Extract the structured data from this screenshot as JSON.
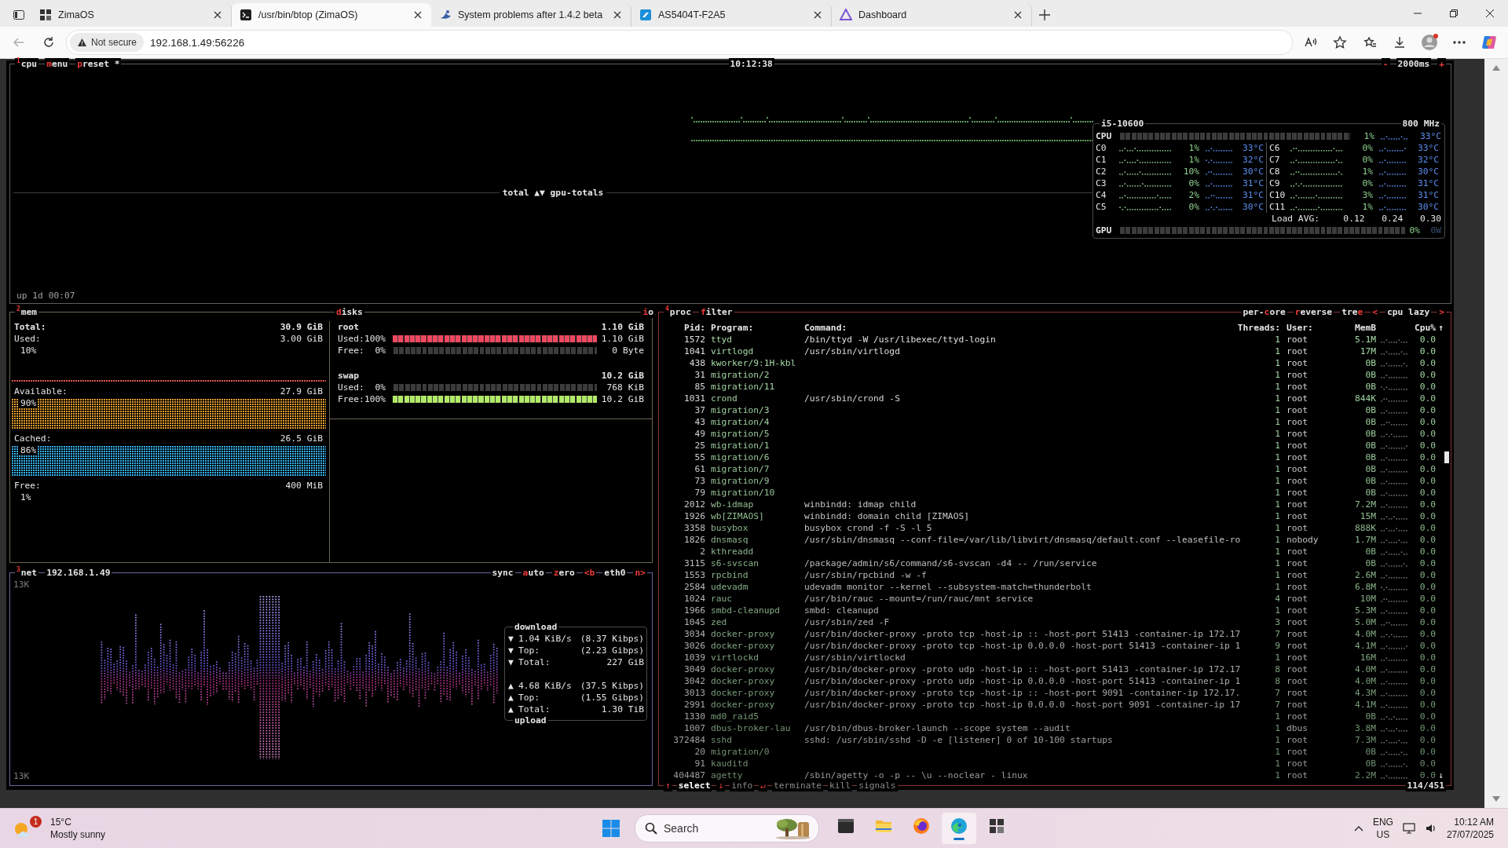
{
  "browser": {
    "tabs": [
      {
        "title": "ZimaOS",
        "kind": "zima",
        "selected": false
      },
      {
        "title": "/usr/bin/btop (ZimaOS)",
        "kind": "terminal",
        "selected": true
      },
      {
        "title": "System problems after 1.4.2 beta",
        "kind": "forum",
        "selected": false
      },
      {
        "title": "AS5404T-F2A5",
        "kind": "nas",
        "selected": false
      },
      {
        "title": "Dashboard",
        "kind": "dashboard",
        "selected": false
      }
    ],
    "security": "Not secure",
    "url": "192.168.1.49:56226"
  },
  "cpu": {
    "title": {
      "number": "1",
      "label": "cpu"
    },
    "buttons": [
      {
        "hotkey": "m",
        "rest": "enu"
      },
      {
        "hotkey": "p",
        "rest": "reset *"
      }
    ],
    "clock": "10:12:38",
    "interval": {
      "minus": "-",
      "value": "2000ms",
      "plus": "+"
    },
    "graph_label": "total ▲▼ gpu-totals",
    "uptime": "up 1d 00:07",
    "model": "i5-10600",
    "frequency": "800 MHz",
    "total": {
      "label": "CPU",
      "percent": "1%",
      "temp": "33°C"
    },
    "cores": [
      {
        "name": "C0",
        "percent": "1%",
        "temp": "33°C"
      },
      {
        "name": "C1",
        "percent": "1%",
        "temp": "32°C"
      },
      {
        "name": "C2",
        "percent": "10%",
        "temp": "30°C"
      },
      {
        "name": "C3",
        "percent": "0%",
        "temp": "31°C"
      },
      {
        "name": "C4",
        "percent": "2%",
        "temp": "31°C"
      },
      {
        "name": "C5",
        "percent": "0%",
        "temp": "30°C"
      },
      {
        "name": "C6",
        "percent": "0%",
        "temp": "33°C"
      },
      {
        "name": "C7",
        "percent": "0%",
        "temp": "32°C"
      },
      {
        "name": "C8",
        "percent": "1%",
        "temp": "30°C"
      },
      {
        "name": "C9",
        "percent": "0%",
        "temp": "31°C"
      },
      {
        "name": "C10",
        "percent": "3%",
        "temp": "31°C"
      },
      {
        "name": "C11",
        "percent": "1%",
        "temp": "30°C"
      }
    ],
    "load": {
      "label": "Load AVG:",
      "values": [
        "0.12",
        "0.24",
        "0.30"
      ]
    },
    "gpu": {
      "label": "GPU",
      "percent": "0%",
      "watts": "0W"
    }
  },
  "mem": {
    "title": {
      "number": "2",
      "label": "mem"
    },
    "total": {
      "label": "Total:",
      "value": "30.9 GiB"
    },
    "stats": [
      {
        "label": "Used:",
        "value": "3.00 GiB",
        "percent": "10%",
        "kind": "line",
        "color": "#e0584f"
      },
      {
        "label": "Available:",
        "value": "27.9 GiB",
        "percent": "90%",
        "kind": "fill",
        "color": "#e8a02c"
      },
      {
        "label": "Cached:",
        "value": "26.5 GiB",
        "percent": "86%",
        "kind": "fill",
        "color": "#35b2ee"
      },
      {
        "label": "Free:",
        "value": "400 MiB",
        "percent": "1%",
        "kind": "none"
      }
    ]
  },
  "disks": {
    "title": {
      "hotkey": "d",
      "rest": "isks"
    },
    "io": {
      "hotkey": "i",
      "rest": "o"
    },
    "devices": [
      {
        "name": "root",
        "size": "1.10 GiB",
        "rows": [
          {
            "label": "Used:",
            "percent": "100%",
            "level": 1,
            "value": "1.10 GiB",
            "kind": "used"
          },
          {
            "label": "Free:",
            "percent": "0%",
            "value": "0 Byte",
            "kind": "free"
          }
        ]
      },
      {
        "name": "swap",
        "size": "10.2 GiB",
        "rows": [
          {
            "label": "Used:",
            "percent": "0%",
            "value": "768 KiB",
            "kind": "used"
          },
          {
            "label": "Free:",
            "percent": "100%",
            "level": 1,
            "value": "10.2 GiB",
            "kind": "free"
          }
        ]
      }
    ]
  },
  "net": {
    "title": {
      "number": "3",
      "label": "net"
    },
    "address": "192.168.1.49",
    "buttons": [
      {
        "rest": "sync"
      },
      {
        "hotkey": "a",
        "rest": "uto"
      },
      {
        "hotkey": "z",
        "rest": "ero"
      }
    ],
    "interface": {
      "prev": "<b",
      "name": "eth0",
      "next": "n>"
    },
    "scale_top": "13K",
    "scale_bottom": "13K",
    "download": {
      "title": "download",
      "rows": [
        {
          "icon": "▼",
          "label": "1.04 KiB/s",
          "value": "(8.37 Kibps)"
        },
        {
          "icon": "▼",
          "label": "Top:",
          "value": "(2.23 Gibps)"
        },
        {
          "icon": "▼",
          "label": "Total:",
          "value": "227 GiB"
        }
      ]
    },
    "upload": {
      "title": "upload",
      "rows": [
        {
          "icon": "▲",
          "label": "4.68 KiB/s",
          "value": "(37.5 Kibps)"
        },
        {
          "icon": "▲",
          "label": "Top:",
          "value": "(1.55 Gibps)"
        },
        {
          "icon": "▲",
          "label": "Total:",
          "value": "1.30 TiB"
        }
      ]
    }
  },
  "proc": {
    "title": {
      "number": "4",
      "label": "proc"
    },
    "filter": {
      "hotkey": "f",
      "rest": "ilter"
    },
    "options": [
      {
        "prefix": "per-",
        "hotkey": "c",
        "rest": "ore"
      },
      {
        "hotkey": "r",
        "rest": "everse"
      },
      {
        "prefix": "tre",
        "hotkey": "e"
      }
    ],
    "sort": {
      "prev": "<",
      "label": "cpu lazy",
      "next": ">"
    },
    "columns": [
      "Pid:",
      "Program:",
      "Command:",
      "Threads:",
      "User:",
      "MemB",
      "Cpu%"
    ],
    "sort_arrow": "↑",
    "end_arrow": "↓",
    "rows": [
      {
        "pid": "1572",
        "program": "ttyd",
        "command": "/bin/ttyd -W /usr/libexec/ttyd-login",
        "threads": "1",
        "user": "root",
        "mem": "5.1M",
        "cpu": "0.0"
      },
      {
        "pid": "1041",
        "program": "virtlogd",
        "command": "/usr/sbin/virtlogd",
        "threads": "1",
        "user": "root",
        "mem": "17M",
        "cpu": "0.0"
      },
      {
        "pid": "438",
        "program": "kworker/9:1H-kbl",
        "threads": "1",
        "user": "root",
        "mem": "0B",
        "cpu": "0.0"
      },
      {
        "pid": "31",
        "program": "migration/2",
        "threads": "1",
        "user": "root",
        "mem": "0B",
        "cpu": "0.0"
      },
      {
        "pid": "85",
        "program": "migration/11",
        "threads": "1",
        "user": "root",
        "mem": "0B",
        "cpu": "0.0"
      },
      {
        "pid": "1031",
        "program": "crond",
        "command": "/usr/sbin/crond -S",
        "threads": "1",
        "user": "root",
        "mem": "844K",
        "cpu": "0.0"
      },
      {
        "pid": "37",
        "program": "migration/3",
        "threads": "1",
        "user": "root",
        "mem": "0B",
        "cpu": "0.0"
      },
      {
        "pid": "43",
        "program": "migration/4",
        "threads": "1",
        "user": "root",
        "mem": "0B",
        "cpu": "0.0"
      },
      {
        "pid": "49",
        "program": "migration/5",
        "threads": "1",
        "user": "root",
        "mem": "0B",
        "cpu": "0.0"
      },
      {
        "pid": "25",
        "program": "migration/1",
        "threads": "1",
        "user": "root",
        "mem": "0B",
        "cpu": "0.0"
      },
      {
        "pid": "55",
        "program": "migration/6",
        "threads": "1",
        "user": "root",
        "mem": "0B",
        "cpu": "0.0"
      },
      {
        "pid": "61",
        "program": "migration/7",
        "threads": "1",
        "user": "root",
        "mem": "0B",
        "cpu": "0.0"
      },
      {
        "pid": "73",
        "program": "migration/9",
        "threads": "1",
        "user": "root",
        "mem": "0B",
        "cpu": "0.0"
      },
      {
        "pid": "79",
        "program": "migration/10",
        "threads": "1",
        "user": "root",
        "mem": "0B",
        "cpu": "0.0"
      },
      {
        "pid": "2012",
        "program": "wb-idmap",
        "command": "winbindd: idmap child",
        "threads": "1",
        "user": "root",
        "mem": "7.2M",
        "cpu": "0.0"
      },
      {
        "pid": "1926",
        "program": "wb[ZIMAOS]",
        "command": "winbindd: domain child [ZIMAOS]",
        "threads": "1",
        "user": "root",
        "mem": "15M",
        "cpu": "0.0"
      },
      {
        "pid": "3358",
        "program": "busybox",
        "command": "busybox crond -f -S -l 5",
        "threads": "1",
        "user": "root",
        "mem": "888K",
        "cpu": "0.0"
      },
      {
        "pid": "1826",
        "program": "dnsmasq",
        "command": "/usr/sbin/dnsmasq --conf-file=/var/lib/libvirt/dnsmasq/default.conf --leasefile-ro",
        "threads": "1",
        "user": "nobody",
        "mem": "1.7M",
        "cpu": "0.0"
      },
      {
        "pid": "2",
        "program": "kthreadd",
        "threads": "1",
        "user": "root",
        "mem": "0B",
        "cpu": "0.0"
      },
      {
        "pid": "3115",
        "program": "s6-svscan",
        "command": "/package/admin/s6/command/s6-svscan -d4 -- /run/service",
        "threads": "1",
        "user": "root",
        "mem": "0B",
        "cpu": "0.0"
      },
      {
        "pid": "1553",
        "program": "rpcbind",
        "command": "/usr/sbin/rpcbind -w -f",
        "threads": "1",
        "user": "root",
        "mem": "2.6M",
        "cpu": "0.0"
      },
      {
        "pid": "2584",
        "program": "udevadm",
        "command": "udevadm monitor --kernel --subsystem-match=thunderbolt",
        "threads": "1",
        "user": "root",
        "mem": "6.8M",
        "cpu": "0.0"
      },
      {
        "pid": "1024",
        "program": "rauc",
        "command": "/usr/bin/rauc --mount=/run/rauc/mnt service",
        "threads": "4",
        "user": "root",
        "mem": "10M",
        "cpu": "0.0"
      },
      {
        "pid": "1966",
        "program": "smbd-cleanupd",
        "command": "smbd: cleanupd",
        "threads": "1",
        "user": "root",
        "mem": "5.3M",
        "cpu": "0.0"
      },
      {
        "pid": "1045",
        "program": "zed",
        "command": "/usr/sbin/zed -F",
        "threads": "3",
        "user": "root",
        "mem": "5.0M",
        "cpu": "0.0"
      },
      {
        "pid": "3034",
        "program": "docker-proxy",
        "command": "/usr/bin/docker-proxy -proto tcp -host-ip :: -host-port 51413 -container-ip 172.17",
        "threads": "7",
        "user": "root",
        "mem": "4.0M",
        "cpu": "0.0"
      },
      {
        "pid": "3026",
        "program": "docker-proxy",
        "command": "/usr/bin/docker-proxy -proto tcp -host-ip 0.0.0.0 -host-port 51413 -container-ip 1",
        "threads": "9",
        "user": "root",
        "mem": "4.1M",
        "cpu": "0.0"
      },
      {
        "pid": "1039",
        "program": "virtlockd",
        "command": "/usr/sbin/virtlockd",
        "threads": "1",
        "user": "root",
        "mem": "16M",
        "cpu": "0.0"
      },
      {
        "pid": "3049",
        "program": "docker-proxy",
        "command": "/usr/bin/docker-proxy -proto udp -host-ip :: -host-port 51413 -container-ip 172.17",
        "threads": "8",
        "user": "root",
        "mem": "4.0M",
        "cpu": "0.0"
      },
      {
        "pid": "3042",
        "program": "docker-proxy",
        "command": "/usr/bin/docker-proxy -proto udp -host-ip 0.0.0.0 -host-port 51413 -container-ip 1",
        "threads": "8",
        "user": "root",
        "mem": "4.0M",
        "cpu": "0.0"
      },
      {
        "pid": "3013",
        "program": "docker-proxy",
        "command": "/usr/bin/docker-proxy -proto tcp -host-ip :: -host-port 9091 -container-ip 172.17.",
        "threads": "7",
        "user": "root",
        "mem": "4.3M",
        "cpu": "0.0"
      },
      {
        "pid": "2991",
        "program": "docker-proxy",
        "command": "/usr/bin/docker-proxy -proto tcp -host-ip 0.0.0.0 -host-port 9091 -container-ip 17",
        "threads": "7",
        "user": "root",
        "mem": "4.1M",
        "cpu": "0.0"
      },
      {
        "pid": "1330",
        "program": "md0_raid5",
        "threads": "1",
        "user": "root",
        "mem": "0B",
        "cpu": "0.0"
      },
      {
        "pid": "1007",
        "program": "dbus-broker-lau",
        "command": "/usr/bin/dbus-broker-launch --scope system --audit",
        "threads": "1",
        "user": "dbus",
        "mem": "3.8M",
        "cpu": "0.0"
      },
      {
        "pid": "372484",
        "program": "sshd",
        "command": "sshd: /usr/sbin/sshd -D -e [listener] 0 of 10-100 startups",
        "threads": "1",
        "user": "root",
        "mem": "7.3M",
        "cpu": "0.0"
      },
      {
        "pid": "20",
        "program": "migration/0",
        "threads": "1",
        "user": "root",
        "mem": "0B",
        "cpu": "0.0"
      },
      {
        "pid": "91",
        "program": "kauditd",
        "threads": "1",
        "user": "root",
        "mem": "0B",
        "cpu": "0.0"
      },
      {
        "pid": "404487",
        "program": "agetty",
        "command": "/sbin/agetty -o -p -- \\u --noclear - linux",
        "threads": "1",
        "user": "root",
        "mem": "2.2M",
        "cpu": "0.0"
      }
    ],
    "footer": [
      {
        "text": "↑",
        "kind": "key"
      },
      {
        "text": "select",
        "kind": "active"
      },
      {
        "text": "↓",
        "kind": "key"
      },
      {
        "text": "info",
        "kind": "dim"
      },
      {
        "text": "↵",
        "kind": "key"
      },
      {
        "text": "terminate",
        "kind": "dim"
      },
      {
        "text": "kill",
        "kind": "dim"
      },
      {
        "text": "signals",
        "kind": "dim"
      }
    ],
    "count": "114/451"
  },
  "taskbar": {
    "weather": {
      "temp": "15°C",
      "condition": "Mostly sunny",
      "badge": "1"
    },
    "search": {
      "placeholder": "Search"
    },
    "apps": [
      {
        "kind": "terminal",
        "selected": false
      },
      {
        "kind": "folder",
        "selected": false
      },
      {
        "kind": "firefox",
        "selected": false
      },
      {
        "kind": "edge",
        "selected": true
      },
      {
        "kind": "zima",
        "selected": false
      }
    ],
    "tray": {
      "language": "ENG",
      "region": "US",
      "time": "10:12 AM",
      "date": "27/07/2025"
    }
  }
}
